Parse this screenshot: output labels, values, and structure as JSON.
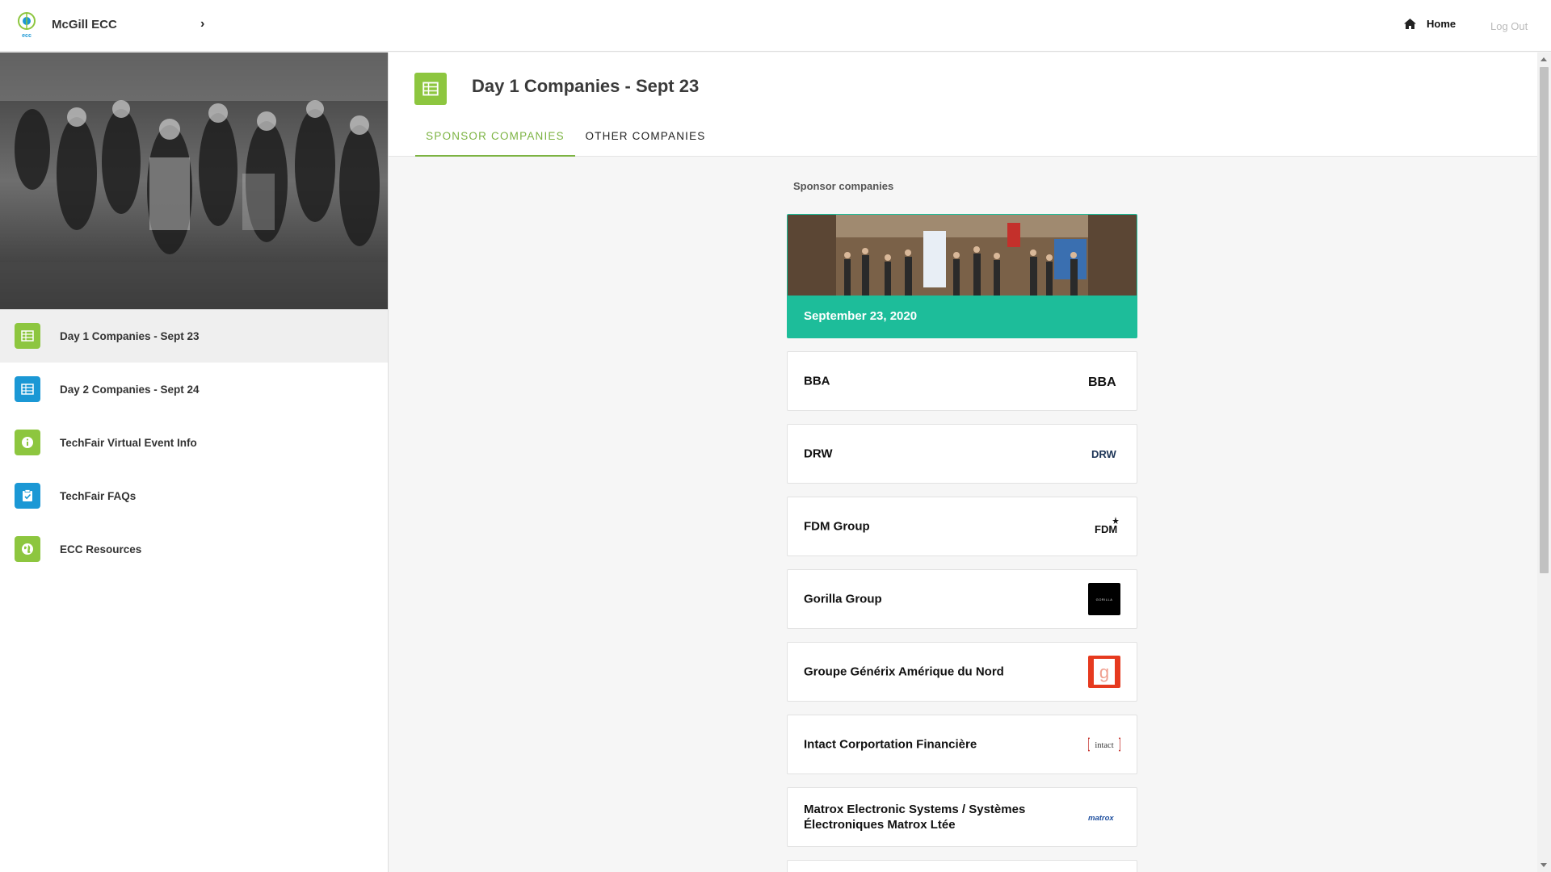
{
  "topbar": {
    "brand_title": "McGill ECC",
    "brand_logo_caption": "ecc",
    "home_label": "Home",
    "logout_label": "Log Out"
  },
  "sidebar": {
    "items": [
      {
        "label": "Day 1 Companies - Sept 23",
        "icon": "building-icon",
        "color": "#8dc63f",
        "active": true
      },
      {
        "label": "Day 2 Companies - Sept 24",
        "icon": "building-icon",
        "color": "#1b98d5",
        "active": false
      },
      {
        "label": "TechFair Virtual Event Info",
        "icon": "info-icon",
        "color": "#8dc63f",
        "active": false
      },
      {
        "label": "TechFair FAQs",
        "icon": "checklist-icon",
        "color": "#1b98d5",
        "active": false
      },
      {
        "label": "ECC Resources",
        "icon": "globe-icon",
        "color": "#8dc63f",
        "active": false
      }
    ]
  },
  "page": {
    "title": "Day 1 Companies - Sept 23",
    "tabs": [
      {
        "label": "SPONSOR COMPANIES",
        "active": true
      },
      {
        "label": "OTHER COMPANIES",
        "active": false
      }
    ],
    "section_label": "Sponsor companies",
    "banner": {
      "date": "September 23, 2020",
      "color": "#1dbd9a"
    },
    "companies": [
      {
        "name": "BBA",
        "logo_text": "BBA"
      },
      {
        "name": "DRW",
        "logo_text": "DRW"
      },
      {
        "name": "FDM Group",
        "logo_text": "FDM"
      },
      {
        "name": "Gorilla Group",
        "logo_text": "GORILLA"
      },
      {
        "name": "Groupe Générix Amérique du Nord",
        "logo_text": "g"
      },
      {
        "name": "Intact Corportation Financière",
        "logo_text": "intact"
      },
      {
        "name": "Matrox Electronic Systems / Systèmes Électroniques Matrox Ltée",
        "logo_text": "matrox"
      }
    ]
  },
  "colors": {
    "accent_green": "#8dc63f",
    "accent_blue": "#1b98d5",
    "tab_active": "#7cb342",
    "teal": "#1dbd9a"
  }
}
